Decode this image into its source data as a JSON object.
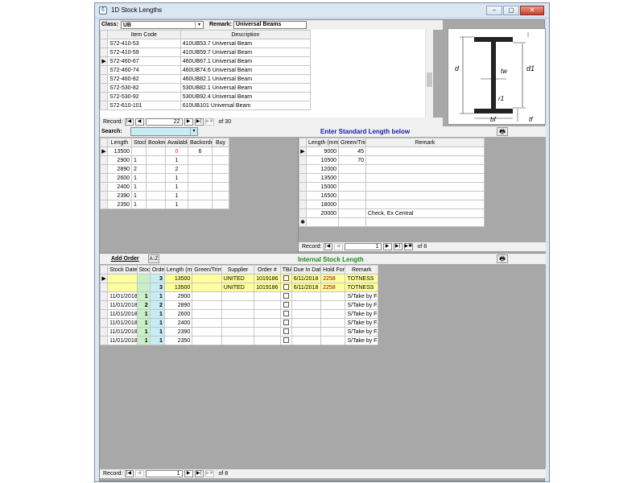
{
  "window": {
    "title": "1D Stock Lengths",
    "min": "–",
    "max": "▢",
    "close": "✕"
  },
  "header": {
    "class_label": "Class:",
    "class_value": "UB",
    "remark_label": "Remark:",
    "remark_value": "Universal Beams"
  },
  "items": {
    "columns": [
      "Item Code",
      "Description"
    ],
    "rows": [
      [
        "S72-410-53",
        "410UB53.7 Universal Beam"
      ],
      [
        "S72-410-59",
        "410UB59.7 Universal Beam"
      ],
      [
        "S72-460-67",
        "460UB67.1 Universal Beam"
      ],
      [
        "S72-460-74",
        "460UB74.6 Universal Beam"
      ],
      [
        "S72-460-82",
        "460UB82.1 Universal Beam"
      ],
      [
        "S72-530-82",
        "530UB82.1 Universal Beam"
      ],
      [
        "S72-530-92",
        "530UB92.4 Universal Beam"
      ],
      [
        "S72-610-101",
        "610UB101 Universal Beam"
      ]
    ],
    "nav": {
      "label": "Record:",
      "current": "22",
      "of": "of 30"
    }
  },
  "diagram": {
    "d": "d",
    "tw": "tw",
    "d1": "d1",
    "r1": "r1",
    "bf": "bf",
    "tf": "tf"
  },
  "search": {
    "label": "Search:",
    "enter_label": "Enter Standard Length below"
  },
  "stock": {
    "columns": [
      "Length",
      "Stock",
      "Booked",
      "Available",
      "Backorder",
      "Buy"
    ],
    "rows": [
      [
        "13500",
        "",
        "",
        "0",
        "6",
        ""
      ],
      [
        "2900",
        "1",
        "",
        "1",
        "",
        ""
      ],
      [
        "2890",
        "2",
        "",
        "2",
        "",
        ""
      ],
      [
        "2600",
        "1",
        "",
        "1",
        "",
        ""
      ],
      [
        "2400",
        "1",
        "",
        "1",
        "",
        ""
      ],
      [
        "2390",
        "1",
        "",
        "1",
        "",
        ""
      ],
      [
        "2350",
        "1",
        "",
        "1",
        "",
        ""
      ]
    ]
  },
  "standard": {
    "columns": [
      "Length (mm)",
      "Green/Trim",
      "Remark"
    ],
    "rows": [
      [
        "9000",
        "45",
        ""
      ],
      [
        "10500",
        "70",
        ""
      ],
      [
        "12000",
        "",
        ""
      ],
      [
        "13500",
        "",
        ""
      ],
      [
        "15000",
        "",
        ""
      ],
      [
        "16500",
        "",
        ""
      ],
      [
        "18000",
        "",
        ""
      ],
      [
        "20000",
        "",
        "Check, Ex Central"
      ]
    ],
    "new_marker": "✱",
    "nav": {
      "label": "Record:",
      "current": "1",
      "of": "of 8"
    }
  },
  "internal": {
    "add_order": "Add Order",
    "sort_icon": "A↓Z",
    "title": "Internal Stock Length",
    "columns": [
      "Stock Date",
      "Stock",
      "Order",
      "Length (mm)",
      "Green/Trim",
      "Supplier",
      "Order #",
      "TBA",
      "Due In Date",
      "Hold For",
      "Remark"
    ],
    "rows": [
      [
        "",
        "",
        "3",
        "13500",
        "",
        "UNITED",
        "1019186",
        "",
        "6/11/2018",
        "2258",
        "TOTNESS"
      ],
      [
        "",
        "",
        "3",
        "13500",
        "",
        "UNITED",
        "1019186",
        "",
        "6/11/2018",
        "2258",
        "TOTNESS"
      ],
      [
        "11/01/2018",
        "1",
        "1",
        "2900",
        "",
        "",
        "",
        "",
        "",
        "",
        "S/Take by Fa"
      ],
      [
        "11/01/2018",
        "2",
        "2",
        "2890",
        "",
        "",
        "",
        "",
        "",
        "",
        "S/Take by Fa"
      ],
      [
        "11/01/2018",
        "1",
        "1",
        "2600",
        "",
        "",
        "",
        "",
        "",
        "",
        "S/Take by Fa"
      ],
      [
        "11/01/2018",
        "1",
        "1",
        "2400",
        "",
        "",
        "",
        "",
        "",
        "",
        "S/Take by Fa"
      ],
      [
        "11/01/2018",
        "1",
        "1",
        "2390",
        "",
        "",
        "",
        "",
        "",
        "",
        "S/Take by Fa"
      ],
      [
        "11/01/2018",
        "1",
        "1",
        "2350",
        "",
        "",
        "",
        "",
        "",
        "",
        "S/Take by Fa"
      ]
    ],
    "nav": {
      "label": "Record:",
      "current": "1",
      "of": "of 8"
    }
  }
}
